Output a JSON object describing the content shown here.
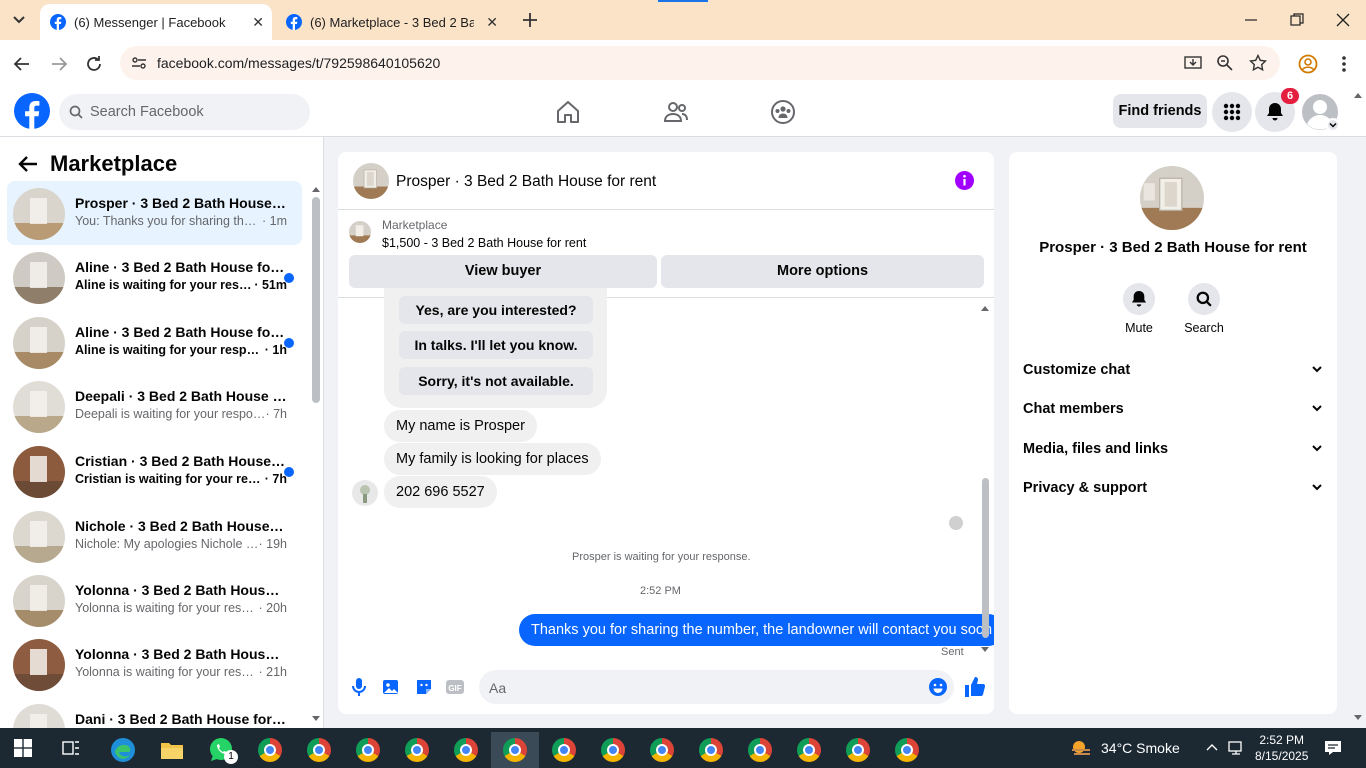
{
  "browser": {
    "tabs": [
      {
        "title": "(6) Messenger | Facebook",
        "active": true
      },
      {
        "title": "(6) Marketplace - 3 Bed 2 Bath H",
        "active": false
      }
    ],
    "url": "facebook.com/messages/t/792598640105620"
  },
  "fb_header": {
    "search_placeholder": "Search Facebook",
    "find_friends": "Find friends",
    "notification_count": "6"
  },
  "sidebar": {
    "title": "Marketplace",
    "conversations": [
      {
        "name": "Prosper · 3 Bed 2 Bath House for rent",
        "preview": "You: Thanks you for sharing the nu...",
        "time": " · 1m",
        "unread": false,
        "selected": true
      },
      {
        "name": "Aline · 3 Bed 2 Bath House for rent",
        "preview": "Aline is waiting for your respo...",
        "time": " · 51m",
        "unread": true,
        "selected": false
      },
      {
        "name": "Aline · 3 Bed 2 Bath House for rent",
        "preview": "Aline is waiting for your respon...",
        "time": " · 1h",
        "unread": true,
        "selected": false
      },
      {
        "name": "Deepali · 3 Bed 2 Bath House for rent",
        "preview": "Deepali is waiting for your response.",
        "time": " · 7h",
        "unread": false,
        "selected": false
      },
      {
        "name": "Cristian · 3 Bed 2 Bath House for rent",
        "preview": "Cristian is waiting for your resp...",
        "time": " · 7h",
        "unread": true,
        "selected": false
      },
      {
        "name": "Nichole · 3 Bed 2 Bath House for rent",
        "preview": "Nichole: My apologies Nichole Bu...",
        "time": " · 19h",
        "unread": false,
        "selected": false
      },
      {
        "name": "Yolonna · 3 Bed 2 Bath House for rent",
        "preview": "Yolonna is waiting for your respo...",
        "time": " · 20h",
        "unread": false,
        "selected": false
      },
      {
        "name": "Yolonna · 3 Bed 2 Bath House for rent",
        "preview": "Yolonna is waiting for your respo...",
        "time": " · 21h",
        "unread": false,
        "selected": false
      },
      {
        "name": "Dani · 3 Bed 2 Bath House for rent",
        "preview": "",
        "time": "",
        "unread": false,
        "selected": false
      }
    ]
  },
  "chat": {
    "title": "Prosper · 3 Bed 2 Bath House for rent",
    "marketplace_label": "Marketplace",
    "listing": "$1,500 - 3 Bed 2 Bath House for rent",
    "view_buyer": "View buyer",
    "more_options": "More options",
    "quick_replies": [
      "Yes, are you interested?",
      "In talks. I'll let you know.",
      "Sorry, it's not available."
    ],
    "messages": [
      "My name is Prosper",
      "My family is looking for places",
      "202 696 5527"
    ],
    "waiting_note": "Prosper is waiting for your response.",
    "timestamp": "2:52 PM",
    "my_message": "Thanks you for sharing the number, the landowner will contact you soon",
    "sent_label": "Sent",
    "composer_placeholder": "Aa"
  },
  "details": {
    "name": "Prosper · 3 Bed 2 Bath House for rent",
    "mute": "Mute",
    "search": "Search",
    "sections": [
      "Customize chat",
      "Chat members",
      "Media, files and links",
      "Privacy & support"
    ]
  },
  "taskbar": {
    "weather": "34°C  Smoke",
    "time": "2:52 PM",
    "date": "8/15/2025",
    "whatsapp_badge": "1"
  },
  "colors": {
    "fb_blue": "#0866ff",
    "tab_bar": "#fbe3c8",
    "taskbar": "#1c2933"
  }
}
